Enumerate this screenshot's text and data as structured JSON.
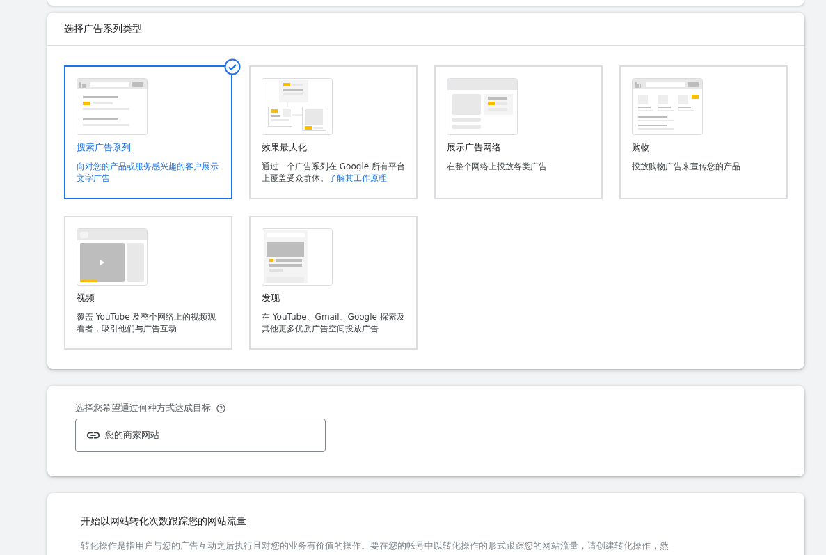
{
  "campaign_type": {
    "title": "选择广告系列类型",
    "tiles": [
      {
        "kind": "search",
        "title": "搜索广告系列",
        "description": "向对您的产品或服务感兴趣的客户展示文字广告",
        "selected": true
      },
      {
        "kind": "performance",
        "title": "效果最大化",
        "description": "通过一个广告系列在 Google 所有平台上覆盖受众群体。",
        "link": "了解其工作原理",
        "selected": false
      },
      {
        "kind": "display",
        "title": "展示广告网络",
        "description": "在整个网络上投放各类广告",
        "selected": false
      },
      {
        "kind": "shopping",
        "title": "购物",
        "description": "投放购物广告来宣传您的产品",
        "selected": false
      },
      {
        "kind": "video",
        "title": "视频",
        "description": "覆盖 YouTube 及整个网络上的视频观看者，吸引他们与广告互动",
        "selected": false
      },
      {
        "kind": "discovery",
        "title": "发现",
        "description": "在 YouTube、Gmail、Google 探索及其他更多优质广告空间投放广告",
        "selected": false
      }
    ]
  },
  "goal": {
    "label": "选择您希望通过何种方式达成目标",
    "value": "您的商家网站"
  },
  "conversion": {
    "title": "开始以网站转化次数跟踪您的网站流量",
    "body": "转化操作是指用户与您的广告互动之后执行且对您的业务有价值的操作。要在您的帐号中以转化操作的形式跟踪您的网站流量，请创建转化操作，然"
  }
}
